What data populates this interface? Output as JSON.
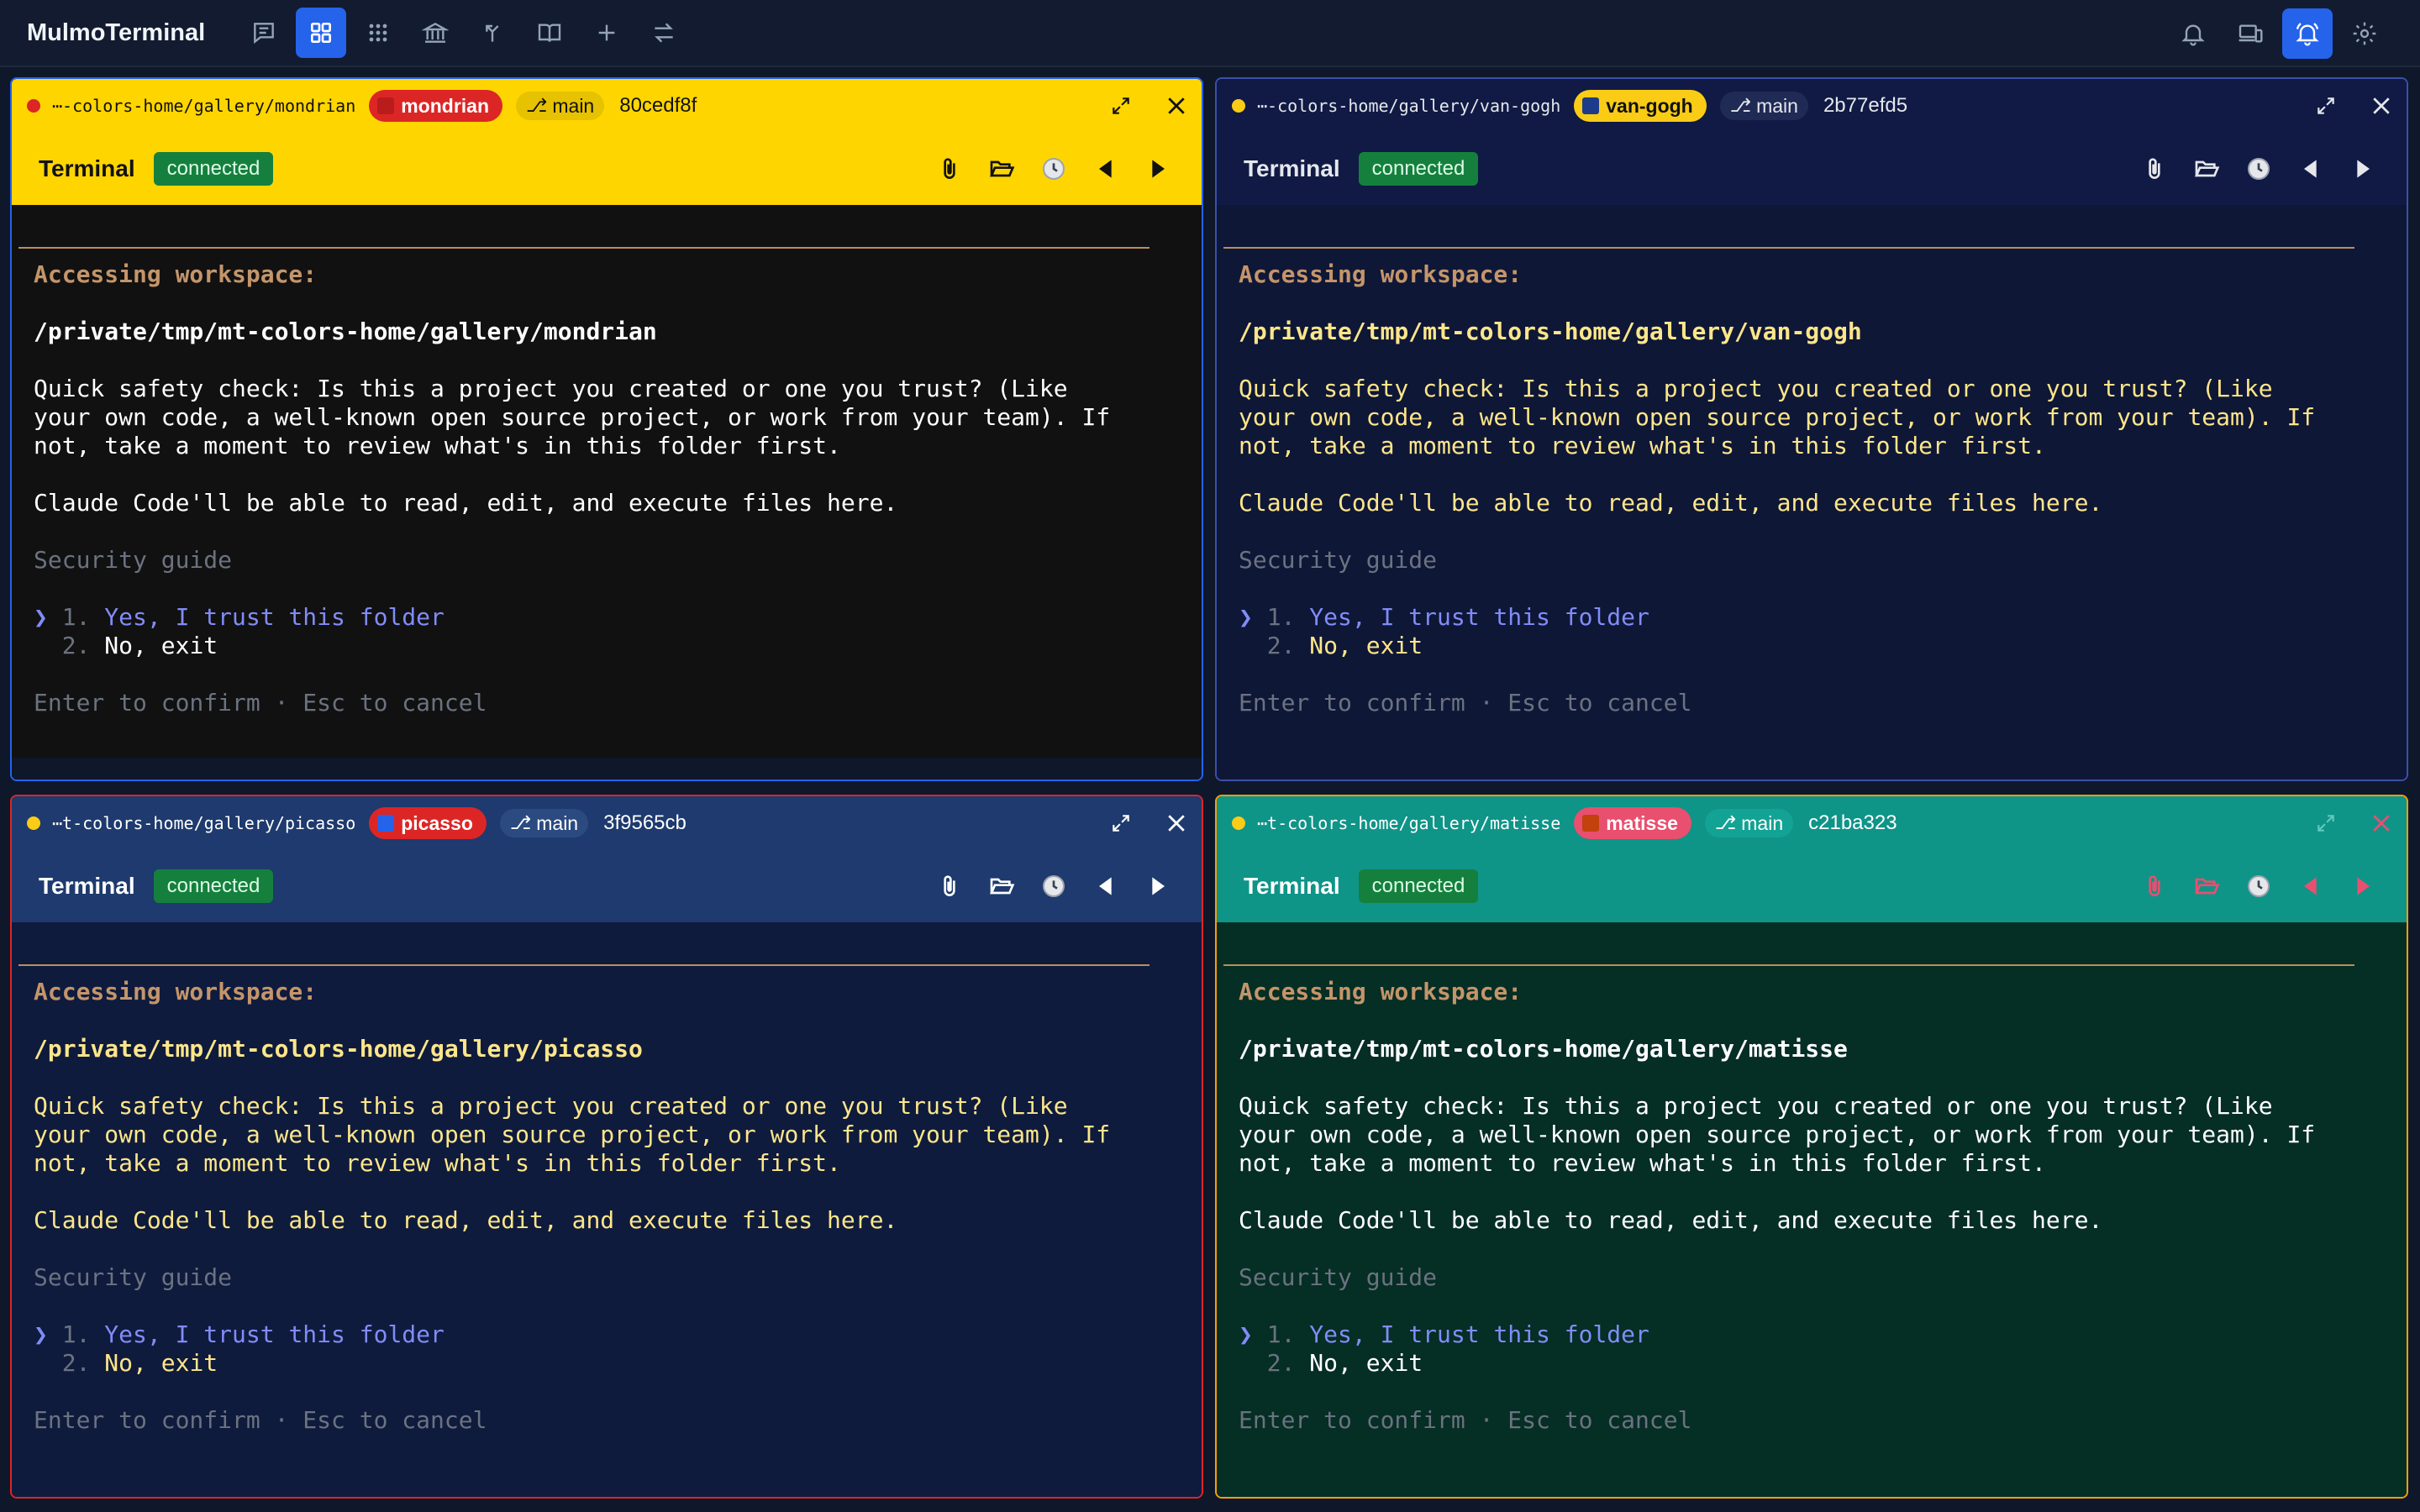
{
  "app": {
    "title": "MulmoTerminal",
    "nav": [
      "chat-icon",
      "grid-icon",
      "apps-icon",
      "bank-icon",
      "merge-icon",
      "book-icon",
      "plus-icon",
      "swap-icon"
    ],
    "right": [
      "bell-icon",
      "devices-icon",
      "bell-ring-icon",
      "gear-icon"
    ]
  },
  "common": {
    "terminal_label": "Terminal",
    "status": "connected",
    "branch": "main",
    "accessing": "Accessing workspace:",
    "quick1": "Quick safety check: Is this a project you created or one you trust? (Like",
    "quick2": "your own code, a well-known open source project, or work from your team). If",
    "quick3": "not, take a moment to review what's in this folder first.",
    "claude": "Claude Code'll be able to read, edit, and execute files here.",
    "security": "Security guide",
    "cursor": "❯",
    "opt1_num": "1.",
    "opt1": "Yes, I trust this folder",
    "opt2_num": "2.",
    "opt2": "No, exit",
    "footer": "Enter to confirm · Esc to cancel"
  },
  "panes": [
    {
      "path": "⋯-colors-home/gallery/mondrian",
      "tag": "mondrian",
      "sha": "80cedf8f",
      "workspace": "/private/tmp/mt-colors-home/gallery/mondrian",
      "colors": {
        "border": "#2563eb",
        "header": "#ffd500",
        "body": "#111111",
        "text": "#ffffff",
        "dot": "#dc2626",
        "tag": "#dc2626",
        "tag_sw": "#b91c1c",
        "ink": "#111111",
        "branch_bg": "#e6c200"
      }
    },
    {
      "path": "⋯-colors-home/gallery/van-gogh",
      "tag": "van-gogh",
      "sha": "2b77efd5",
      "workspace": "/private/tmp/mt-colors-home/gallery/van-gogh",
      "colors": {
        "border": "#3b4fa8",
        "header": "#101a45",
        "body": "#0f1737",
        "text": "#fde68a",
        "dot": "#facc15",
        "tag": "#facc15",
        "tag_sw": "#1e3a8a",
        "ink": "#e5e7eb",
        "branch_bg": "#1f2a55"
      }
    },
    {
      "path": "⋯t-colors-home/gallery/picasso",
      "tag": "picasso",
      "sha": "3f9565cb",
      "workspace": "/private/tmp/mt-colors-home/gallery/picasso",
      "colors": {
        "border": "#dc2626",
        "header": "#1e3a6e",
        "body": "#0f1b3d",
        "text": "#fde68a",
        "dot": "#facc15",
        "tag": "#dc2626",
        "tag_sw": "#2563eb",
        "ink": "#ffffff",
        "branch_bg": "#2b4a80"
      }
    },
    {
      "path": "⋯t-colors-home/gallery/matisse",
      "tag": "matisse",
      "sha": "c21ba323",
      "workspace": "/private/tmp/mt-colors-home/gallery/matisse",
      "colors": {
        "border": "#f59e0b",
        "header": "#0f9488",
        "body": "#052e25",
        "text": "#ffffff",
        "dot": "#facc15",
        "tag": "#e94f6f",
        "tag_sw": "#c2410c",
        "ink": "#ffffff",
        "branch_bg": "#13a394"
      }
    }
  ]
}
